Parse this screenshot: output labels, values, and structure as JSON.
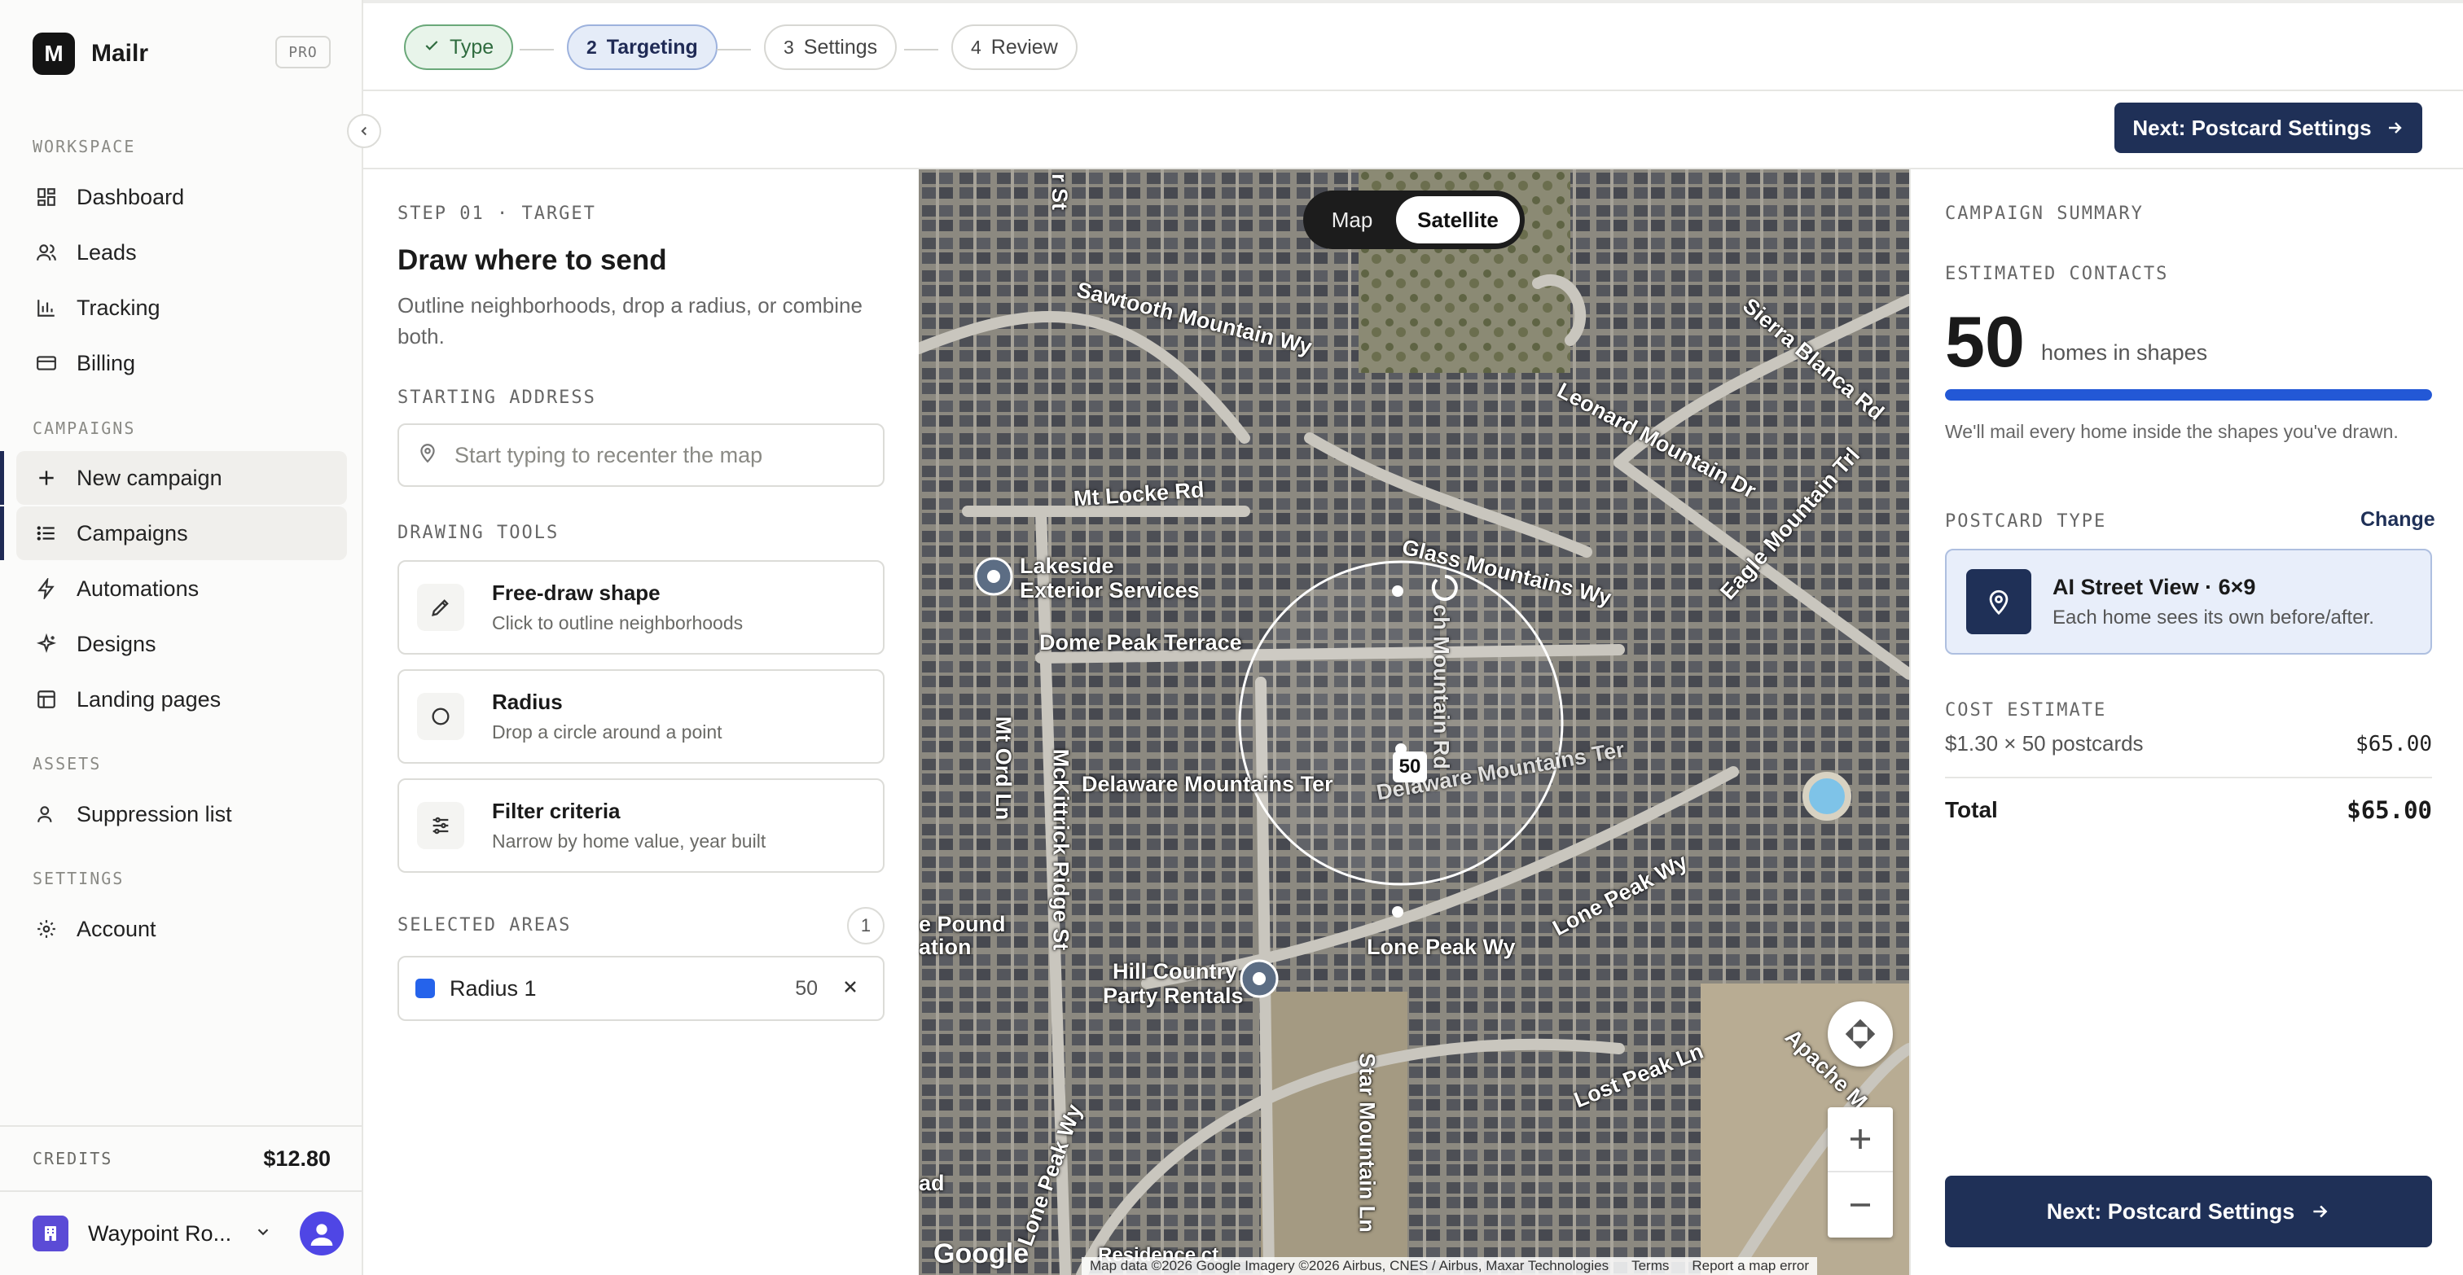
{
  "app": {
    "logo_letter": "M",
    "name": "Mailr",
    "plan_badge": "PRO"
  },
  "sidebar": {
    "sections": {
      "workspace": "WORKSPACE",
      "campaigns": "CAMPAIGNS",
      "assets": "ASSETS",
      "settings": "SETTINGS"
    },
    "items": [
      {
        "label": "Dashboard",
        "icon": "grid-icon"
      },
      {
        "label": "Leads",
        "icon": "users-icon"
      },
      {
        "label": "Tracking",
        "icon": "bar-chart-icon"
      },
      {
        "label": "Billing",
        "icon": "credit-card-icon"
      },
      {
        "label": "New campaign",
        "icon": "plus-icon"
      },
      {
        "label": "Campaigns",
        "icon": "list-icon"
      },
      {
        "label": "Automations",
        "icon": "lightning-icon"
      },
      {
        "label": "Designs",
        "icon": "sparkle-icon"
      },
      {
        "label": "Landing pages",
        "icon": "layout-icon"
      },
      {
        "label": "Suppression list",
        "icon": "user-x-icon"
      },
      {
        "label": "Account",
        "icon": "gear-icon"
      }
    ],
    "credits_label": "CREDITS",
    "credits_value": "$12.80",
    "workspace_name": "Waypoint Ro..."
  },
  "stepper": {
    "steps": [
      {
        "num": "",
        "label": "Type",
        "state": "done"
      },
      {
        "num": "2",
        "label": "Targeting",
        "state": "current"
      },
      {
        "num": "3",
        "label": "Settings",
        "state": "upcoming"
      },
      {
        "num": "4",
        "label": "Review",
        "state": "upcoming"
      }
    ]
  },
  "actions": {
    "next_label": "Next: Postcard Settings"
  },
  "panel": {
    "eyebrow": "STEP 01 · TARGET",
    "title": "Draw where to send",
    "description": "Outline neighborhoods, drop a radius, or combine both.",
    "address_label": "STARTING ADDRESS",
    "address_placeholder": "Start typing to recenter the map",
    "tools_label": "DRAWING TOOLS",
    "tools": [
      {
        "title": "Free-draw shape",
        "subtitle": "Click to outline neighborhoods"
      },
      {
        "title": "Radius",
        "subtitle": "Drop a circle around a point"
      },
      {
        "title": "Filter criteria",
        "subtitle": "Narrow by home value, year built"
      }
    ],
    "selected_label": "SELECTED AREAS",
    "selected_count": "1",
    "areas": [
      {
        "name": "Radius 1",
        "count": "50",
        "color": "#2563eb"
      }
    ]
  },
  "map": {
    "toggle": {
      "map": "Map",
      "satellite": "Satellite",
      "selected": "Satellite"
    },
    "radius_count": "50",
    "labels": {
      "sawtooth": "Sawtooth Mountain Wy",
      "sierra": "Sierra Blanca Rd",
      "leonard": "Leonard Mountain Dr",
      "eagle": "Eagle Mountain Trl",
      "locke": "Mt Locke Rd",
      "lakeside1": "Lakeside",
      "lakeside2": "Exterior Services",
      "glass": "Glass Mountains Wy",
      "dome": "Dome Peak Terrace",
      "delaware": "Delaware Mountains Ter",
      "delaware2": "Delaware Mountains Ter",
      "mcKittrick": "McKittrick Ridge St",
      "ord": "Mt Ord Ln",
      "lonepeakwy": "Lone Peak Wy",
      "lonepeakwy2": "Lone Peak Wy",
      "hill1": "Hill Country",
      "hill2": "Party Rentals",
      "star": "Star Mountain Ln",
      "lostpeak": "Lost Peak Ln",
      "apache": "Apache M",
      "church": "ch Mountain Rd",
      "pound1": "e Pound",
      "pound2": "ation",
      "residence": "Residence ct",
      "road_left": "ad",
      "st_top": "r St"
    },
    "google": "Google",
    "attribution": "Map data ©2026 Google Imagery ©2026 Airbus, CNES / Airbus, Maxar Technologies",
    "terms": "Terms",
    "report": "Report a map error"
  },
  "summary": {
    "eyebrow": "CAMPAIGN SUMMARY",
    "contacts_label": "ESTIMATED CONTACTS",
    "contacts_value": "50",
    "contacts_unit": "homes in shapes",
    "coverage_fraction": 1.0,
    "note": "We'll mail every home inside the shapes you've drawn.",
    "postcard_label": "POSTCARD TYPE",
    "change_label": "Change",
    "postcard_title": "AI Street View · 6×9",
    "postcard_sub": "Each home sees its own before/after.",
    "cost_label": "COST ESTIMATE",
    "cost_line": "$1.30 × 50 postcards",
    "cost_line_value": "$65.00",
    "total_label": "Total",
    "total_value": "$65.00",
    "next_label": "Next: Postcard Settings"
  },
  "colors": {
    "primary": "#1f3057",
    "accent_blue": "#2358d6",
    "done_green": "#2e6b3e"
  }
}
